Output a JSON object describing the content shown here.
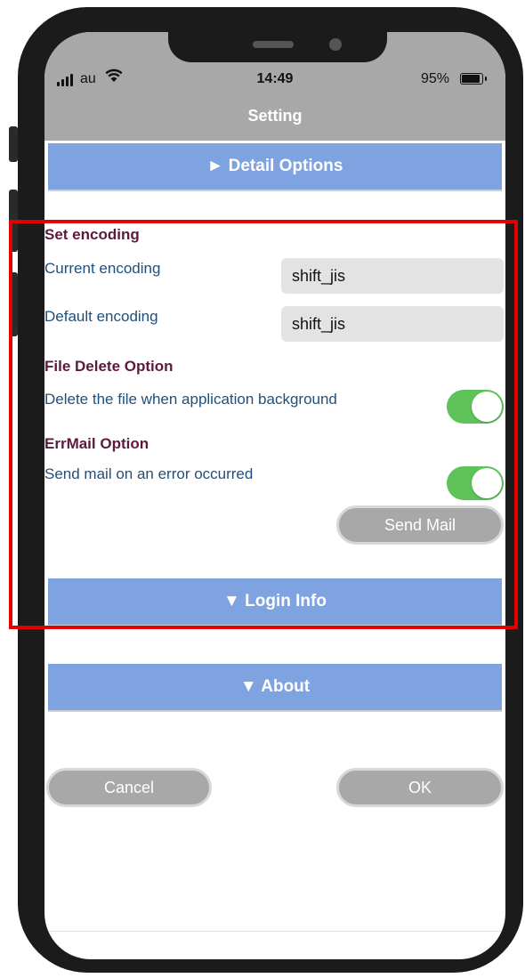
{
  "status_bar": {
    "carrier": "au",
    "time": "14:49",
    "battery": "95%"
  },
  "header": {
    "title": "Setting"
  },
  "sections": {
    "detail_options": "► Detail Options",
    "login_info": "▼ Login Info",
    "about": "▼ About"
  },
  "encoding": {
    "heading": "Set encoding",
    "current_label": "Current encoding",
    "current_value": "shift_jis",
    "default_label": "Default encoding",
    "default_value": "shift_jis"
  },
  "file_delete": {
    "heading": "File Delete Option",
    "label": "Delete the file when application background",
    "enabled": true
  },
  "err_mail": {
    "heading": "ErrMail Option",
    "label": "Send mail on an error occurred",
    "enabled": true,
    "send_button": "Send Mail"
  },
  "actions": {
    "cancel": "Cancel",
    "ok": "OK"
  },
  "colors": {
    "section_bar": "#7ea3e0",
    "heading": "#5d1a3b",
    "label": "#1f4f7a",
    "toggle_on": "#5ec35b",
    "highlight": "#e30000"
  },
  "icons": {
    "signal": "cellular-signal-icon",
    "wifi": "wifi-icon",
    "battery": "battery-icon"
  }
}
